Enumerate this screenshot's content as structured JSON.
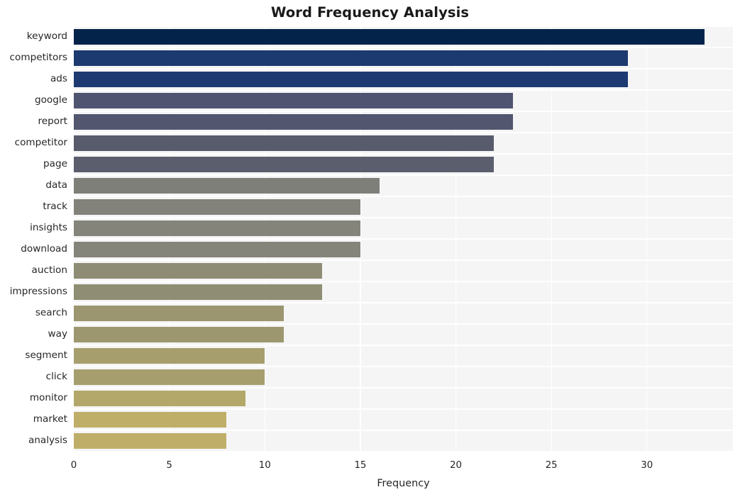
{
  "chart_data": {
    "type": "bar",
    "orientation": "horizontal",
    "title": "Word Frequency Analysis",
    "xlabel": "Frequency",
    "ylabel": "",
    "categories": [
      "keyword",
      "competitors",
      "ads",
      "google",
      "report",
      "competitor",
      "page",
      "data",
      "track",
      "insights",
      "download",
      "auction",
      "impressions",
      "search",
      "way",
      "segment",
      "click",
      "monitor",
      "market",
      "analysis"
    ],
    "values": [
      33,
      29,
      29,
      23,
      23,
      22,
      22,
      16,
      15,
      15,
      15,
      13,
      13,
      11,
      11,
      10,
      10,
      9,
      8,
      8
    ],
    "bar_colors": [
      "#04234b",
      "#1d3a70",
      "#1d3a72",
      "#4f5470",
      "#52576f",
      "#575b6c",
      "#5a5e6d",
      "#7f7f79",
      "#83827a",
      "#85847a",
      "#85847a",
      "#8e8c74",
      "#8f8d74",
      "#9b9670",
      "#9c976f",
      "#a69e6d",
      "#a69e6d",
      "#b3a86a",
      "#bfae68",
      "#bfae68"
    ],
    "xlim": [
      0,
      34.5
    ],
    "xticks": [
      0,
      5,
      10,
      15,
      20,
      25,
      30
    ],
    "xticklabels": [
      "0",
      "5",
      "10",
      "15",
      "20",
      "25",
      "30"
    ],
    "grid": true,
    "grid_color": "#ffffff",
    "plot_background": "#f5f5f6",
    "figure_background": "#ffffff",
    "legend": null
  }
}
